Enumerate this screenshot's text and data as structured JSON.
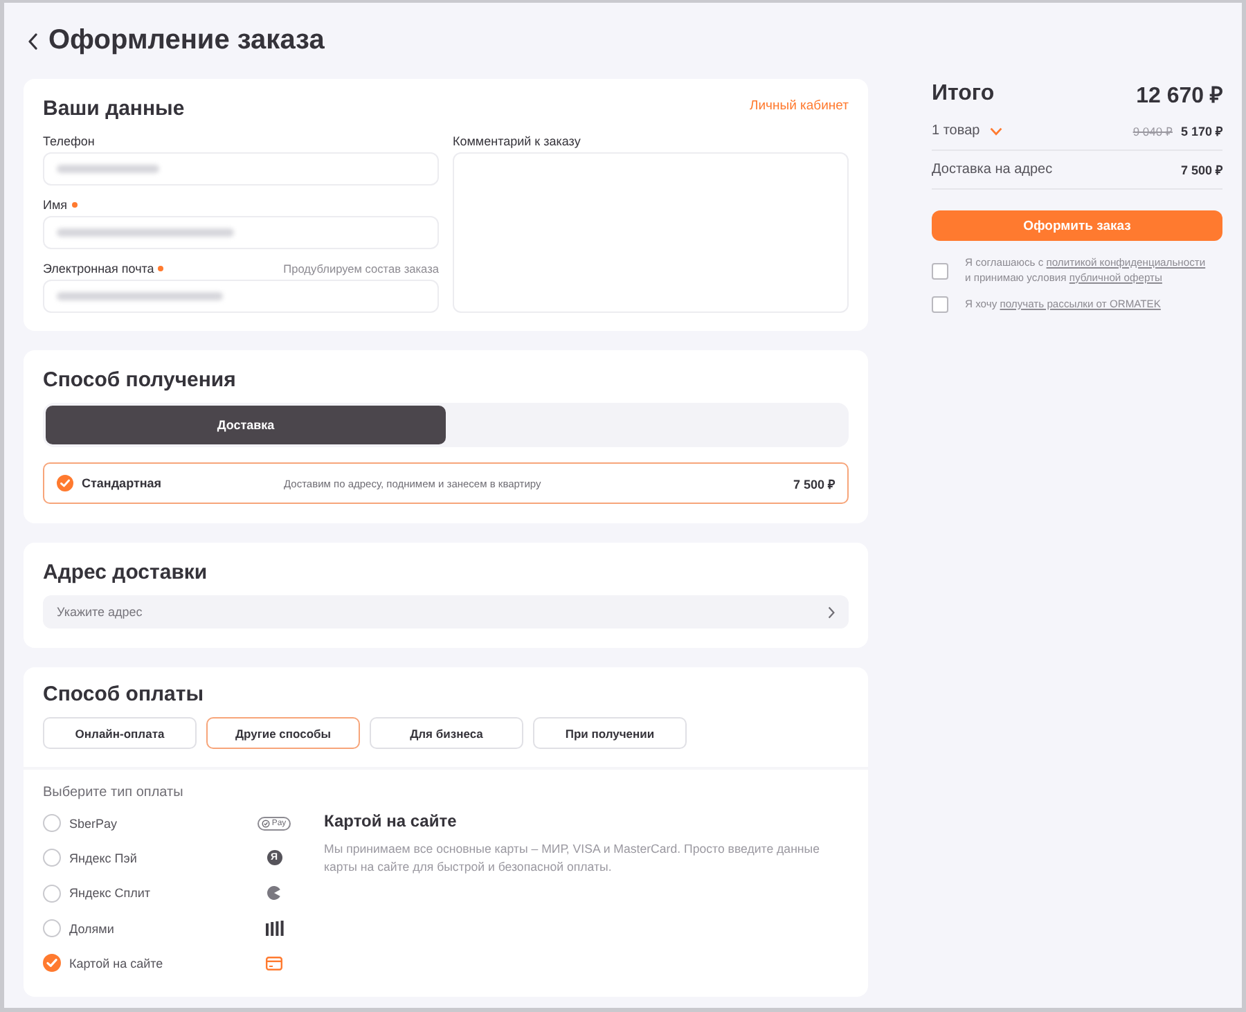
{
  "header": {
    "title": "Оформление заказа"
  },
  "contact": {
    "title": "Ваши данные",
    "account_link": "Личный кабинет",
    "fields": [
      {
        "label": "Телефон",
        "required": false,
        "redacted": true
      },
      {
        "label": "Имя",
        "required": true,
        "redacted": true
      },
      {
        "label": "Электронная почта",
        "required": true,
        "hint": "Продублируем состав заказа",
        "redacted": true
      }
    ],
    "comment": {
      "label": "Комментарий к заказу"
    }
  },
  "receiving": {
    "title": "Способ получения",
    "modes": [
      {
        "label": "Доставка",
        "selected": true
      }
    ],
    "options": [
      {
        "name": "Стандартная",
        "description": "Доставим по адресу, поднимем и занесем в квартиру",
        "price": "7 500 ₽",
        "selected": true
      }
    ]
  },
  "address": {
    "title": "Адрес доставки",
    "placeholder": "Укажите адрес"
  },
  "payment": {
    "title": "Способ оплаты",
    "tabs": [
      {
        "label": "Онлайн-оплата",
        "selected": false
      },
      {
        "label": "Другие способы",
        "selected": true
      },
      {
        "label": "Для бизнеса",
        "selected": false
      },
      {
        "label": "При получении",
        "selected": false
      }
    ],
    "prompt": "Выберите тип оплаты",
    "methods": [
      {
        "label": "SberPay",
        "kind": "pill",
        "logo_text": "Pay",
        "selected": false
      },
      {
        "label": "Яндекс Пэй",
        "kind": "disc",
        "logo_text": "Я",
        "selected": false
      },
      {
        "label": "Яндекс Сплит",
        "kind": "pie",
        "selected": false
      },
      {
        "label": "Долями",
        "kind": "bars",
        "selected": false
      },
      {
        "label": "Картой на сайте",
        "kind": "card",
        "selected": true
      }
    ],
    "details": {
      "title": "Картой на сайте",
      "text": "Мы принимаем все основные карты – МИР, VISA и MasterCard. Просто введите данные карты на сайте для быстрой и безопасной оплаты."
    }
  },
  "summary": {
    "title": "Итого",
    "total": "12 670 ₽",
    "items": {
      "label": "1 товар",
      "expanded": false,
      "old_price": "9 040 ₽",
      "price": "5 170 ₽"
    },
    "delivery": {
      "label": "Доставка на адрес",
      "price": "7 500 ₽"
    },
    "submit": "Оформить заказ",
    "consents": [
      {
        "checked": false,
        "parts": [
          {
            "kind": "text",
            "text": "Я соглашаюсь с"
          },
          {
            "kind": "link",
            "text": "политикой конфиденциальности"
          },
          {
            "kind": "text",
            "text": "и принимаю условия"
          },
          {
            "kind": "link",
            "text": "публичной оферты"
          }
        ]
      },
      {
        "checked": false,
        "parts": [
          {
            "kind": "text",
            "text": "Я хочу"
          },
          {
            "kind": "link",
            "text": "получать рассылки от ORMATEK"
          }
        ]
      }
    ]
  }
}
